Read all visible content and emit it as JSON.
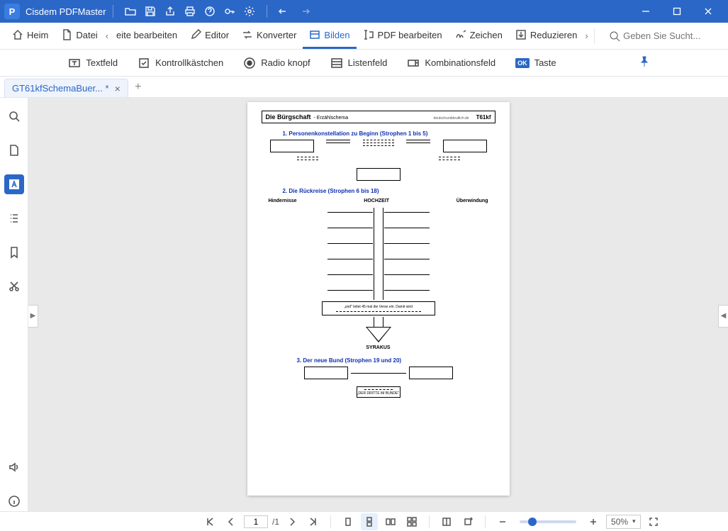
{
  "app": {
    "title": "Cisdem PDFMaster"
  },
  "mainToolbar": {
    "home": "Heim",
    "file": "Datei",
    "editPage": "eite bearbeiten",
    "editor": "Editor",
    "converter": "Konverter",
    "form": "Bilden",
    "editPdf": "PDF bearbeiten",
    "sign": "Zeichen",
    "reduce": "Reduzieren"
  },
  "search": {
    "placeholder": "Geben Sie Sucht..."
  },
  "formToolbar": {
    "textfield": "Textfeld",
    "checkbox": "Kontrollkästchen",
    "radio": "Radio knopf",
    "listbox": "Listenfeld",
    "combobox": "Kombinationsfeld",
    "ok_badge": "OK",
    "button": "Taste"
  },
  "tabs": {
    "active": "GT61kfSchemaBuer... *"
  },
  "statusbar": {
    "page_current": "1",
    "page_total": "/1",
    "zoom": "50%"
  },
  "document": {
    "header_title": "Die Bürgschaft",
    "header_sub": "- Erzählschema",
    "header_source": "deutschunddeutlich.de",
    "header_code": "T61kf",
    "section1": "1. Personenkonstellation zu Beginn (Strophen 1 bis 5)",
    "section2": "2. Die Rückreise (Strophen 6 bis 18)",
    "col_left": "Hindernisse",
    "col_mid": "HOCHZEIT",
    "col_right": "Überwindung",
    "note": "„und\" leitet 45 mal die Verse ein. Damit wird",
    "syrakus": "SYRAKUS",
    "section3": "3. Der neue Bund (Strophen 19 und 20)",
    "final_note": "„DER DRITTE IM BUNDE\""
  }
}
